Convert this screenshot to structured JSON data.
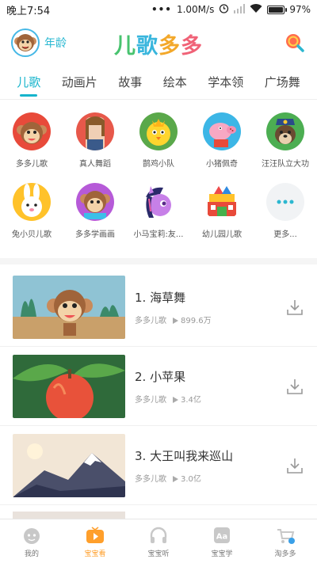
{
  "status_bar": {
    "time": "晚上7:54",
    "network_speed": "1.00M/s",
    "battery_percent": "97%",
    "battery_level": 0.97
  },
  "header": {
    "age_label": "年龄",
    "logo_chars": [
      "儿",
      "歌",
      "多",
      "多"
    ]
  },
  "tabs": [
    {
      "label": "儿歌",
      "active": true
    },
    {
      "label": "动画片",
      "active": false
    },
    {
      "label": "故事",
      "active": false
    },
    {
      "label": "绘本",
      "active": false
    },
    {
      "label": "学本领",
      "active": false
    },
    {
      "label": "广场舞",
      "active": false
    }
  ],
  "categories": [
    {
      "label": "多多儿歌",
      "icon": "monkey-icon"
    },
    {
      "label": "真人舞蹈",
      "icon": "dancer-girl-icon"
    },
    {
      "label": "鹊鸡小队",
      "icon": "yellow-chick-icon"
    },
    {
      "label": "小猪佩奇",
      "icon": "pink-pig-icon"
    },
    {
      "label": "汪汪队立大功",
      "icon": "puppy-police-icon"
    },
    {
      "label": "兔小贝儿歌",
      "icon": "bunny-icon"
    },
    {
      "label": "多多学画画",
      "icon": "monkey-painting-icon"
    },
    {
      "label": "小马宝莉:友...",
      "icon": "purple-pony-icon"
    },
    {
      "label": "幼儿园儿歌",
      "icon": "kindergarten-icon"
    },
    {
      "label": "更多...",
      "icon": "more-icon"
    }
  ],
  "songs": [
    {
      "title": "1. 海草舞",
      "source": "多多儿歌",
      "plays": "899.6万"
    },
    {
      "title": "2. 小苹果",
      "source": "多多儿歌",
      "plays": "3.4亿"
    },
    {
      "title": "3. 大王叫我来巡山",
      "source": "多多儿歌",
      "plays": "3.0亿"
    }
  ],
  "bottom_nav": [
    {
      "label": "我的",
      "icon": "baby-face-icon",
      "active": false
    },
    {
      "label": "宝宝看",
      "icon": "tv-play-icon",
      "active": true
    },
    {
      "label": "宝宝听",
      "icon": "headphones-icon",
      "active": false
    },
    {
      "label": "宝宝学",
      "icon": "learn-aa-icon",
      "active": false
    },
    {
      "label": "淘多多",
      "icon": "shopping-cart-icon",
      "active": false
    }
  ],
  "colors": {
    "accent": "#16b4cc",
    "nav_active": "#ff9f2b"
  }
}
